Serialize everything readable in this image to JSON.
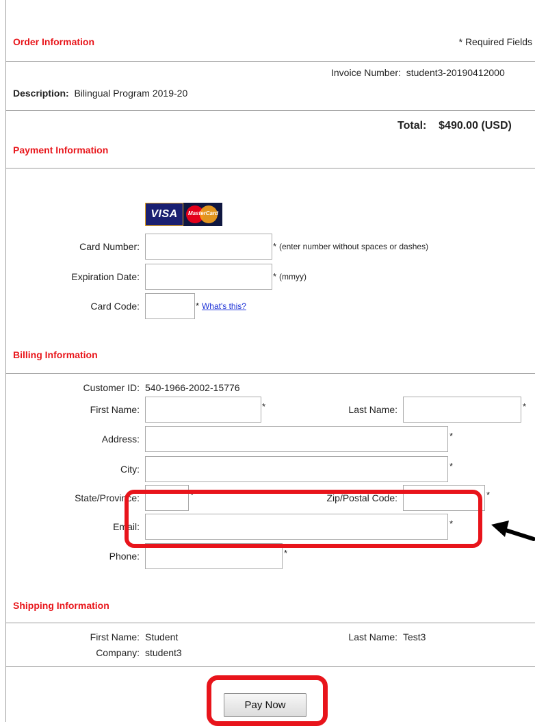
{
  "order": {
    "title": "Order Information",
    "required_note": "* Required Fields",
    "invoice_label": "Invoice Number:",
    "invoice_value": "student3-20190412000",
    "description_label": "Description:",
    "description_value": "Bilingual Program 2019-20",
    "total_label": "Total:",
    "total_value": "$490.00 (USD)"
  },
  "payment": {
    "title": "Payment Information",
    "card_brands": [
      "VISA",
      "MasterCard"
    ],
    "card_number_label": "Card Number:",
    "card_number_hint": "(enter number without spaces or dashes)",
    "expiration_label": "Expiration Date:",
    "expiration_hint": "(mmyy)",
    "card_code_label": "Card Code:",
    "whats_this": "What's this?"
  },
  "billing": {
    "title": "Billing Information",
    "customer_id_label": "Customer ID:",
    "customer_id_value": "540-1966-2002-15776",
    "first_name_label": "First Name:",
    "last_name_label": "Last Name:",
    "address_label": "Address:",
    "city_label": "City:",
    "state_label": "State/Province:",
    "zip_label": "Zip/Postal Code:",
    "email_label": "Email:",
    "phone_label": "Phone:"
  },
  "shipping": {
    "title": "Shipping Information",
    "first_name_label": "First Name:",
    "first_name_value": "Student",
    "last_name_label": "Last Name:",
    "last_name_value": "Test3",
    "company_label": "Company:",
    "company_value": "student3"
  },
  "required_marker": "*",
  "pay_button": "Pay Now",
  "colors": {
    "section_title": "#e8161b",
    "callout": "#e8141b",
    "link": "#1a2fd6"
  }
}
